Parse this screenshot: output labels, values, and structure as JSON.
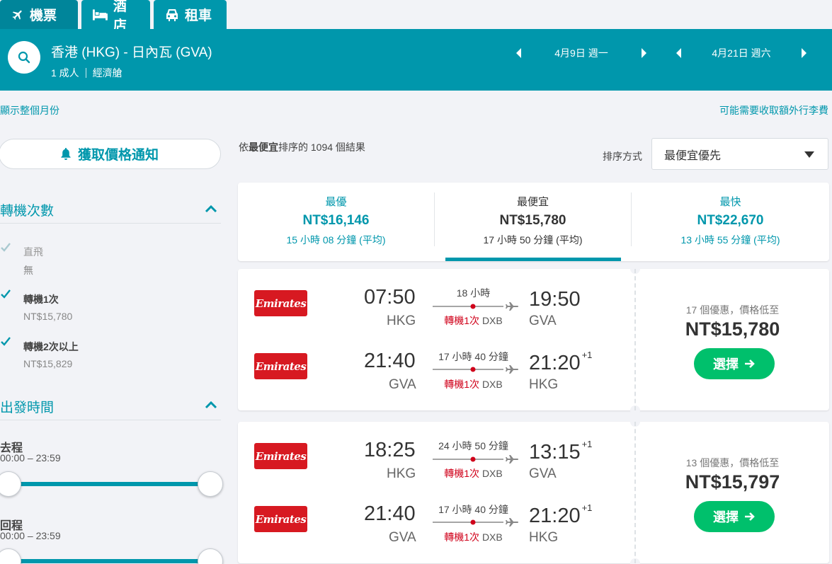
{
  "tabs": [
    {
      "label": "機票",
      "icon": "plane-icon"
    },
    {
      "label": "酒店",
      "icon": "bed-icon"
    },
    {
      "label": "租車",
      "icon": "car-icon"
    }
  ],
  "header": {
    "route": "香港 (HKG) - 日內瓦 (GVA)",
    "pax": "1 成人",
    "cabin": "經濟艙",
    "depart_date": "4月9日 週一",
    "return_date": "4月21日 週六"
  },
  "links": {
    "show_month": "顯示整個月份",
    "baggage": "可能需要收取額外行李費"
  },
  "sidebar": {
    "alert_label": "獲取價格通知",
    "stops_title": "轉機次數",
    "stops": [
      {
        "label": "直飛",
        "price": "無",
        "checked": true,
        "disabled": true
      },
      {
        "label": "轉機1次",
        "price": "NT$15,780",
        "checked": true,
        "disabled": false
      },
      {
        "label": "轉機2次以上",
        "price": "NT$15,829",
        "checked": true,
        "disabled": false
      }
    ],
    "times_title": "出發時間",
    "outbound_label": "去程",
    "outbound_range": "00:00 – 23:59",
    "inbound_label": "回程",
    "inbound_range": "00:00 – 23:59"
  },
  "results": {
    "count_prefix": "依",
    "count_bold": "最便宜",
    "count_suffix": "排序的 1094 個結果",
    "sort_label": "排序方式",
    "sort_value": "最便宜優先"
  },
  "sort_tabs": [
    {
      "name": "最優",
      "price": "NT$16,146",
      "duration": "15 小時 08 分鐘 (平均)"
    },
    {
      "name": "最便宜",
      "price": "NT$15,780",
      "duration": "17 小時 50 分鐘 (平均)"
    },
    {
      "name": "最快",
      "price": "NT$22,670",
      "duration": "13 小時 55 分鐘 (平均)"
    }
  ],
  "flights": [
    {
      "deals": "17 個優惠，價格低至",
      "price": "NT$15,780",
      "select": "選擇",
      "legs": [
        {
          "airline": "Emirates",
          "dep_time": "07:50",
          "dep_ap": "HKG",
          "arr_time": "19:50",
          "arr_plus": "",
          "arr_ap": "GVA",
          "duration": "18 小時",
          "stops": "轉機1次",
          "via": "DXB"
        },
        {
          "airline": "Emirates",
          "dep_time": "21:40",
          "dep_ap": "GVA",
          "arr_time": "21:20",
          "arr_plus": "+1",
          "arr_ap": "HKG",
          "duration": "17 小時 40 分鐘",
          "stops": "轉機1次",
          "via": "DXB"
        }
      ]
    },
    {
      "deals": "13 個優惠，價格低至",
      "price": "NT$15,797",
      "select": "選擇",
      "legs": [
        {
          "airline": "Emirates",
          "dep_time": "18:25",
          "dep_ap": "HKG",
          "arr_time": "13:15",
          "arr_plus": "+1",
          "arr_ap": "GVA",
          "duration": "24 小時 50 分鐘",
          "stops": "轉機1次",
          "via": "DXB"
        },
        {
          "airline": "Emirates",
          "dep_time": "21:40",
          "dep_ap": "GVA",
          "arr_time": "21:20",
          "arr_plus": "+1",
          "arr_ap": "HKG",
          "duration": "17 小時 40 分鐘",
          "stops": "轉機1次",
          "via": "DXB"
        }
      ]
    }
  ],
  "colors": {
    "teal": "#0097ac",
    "green": "#00c06c",
    "emirates_red": "#d71921",
    "stop_red": "#d0021b"
  }
}
